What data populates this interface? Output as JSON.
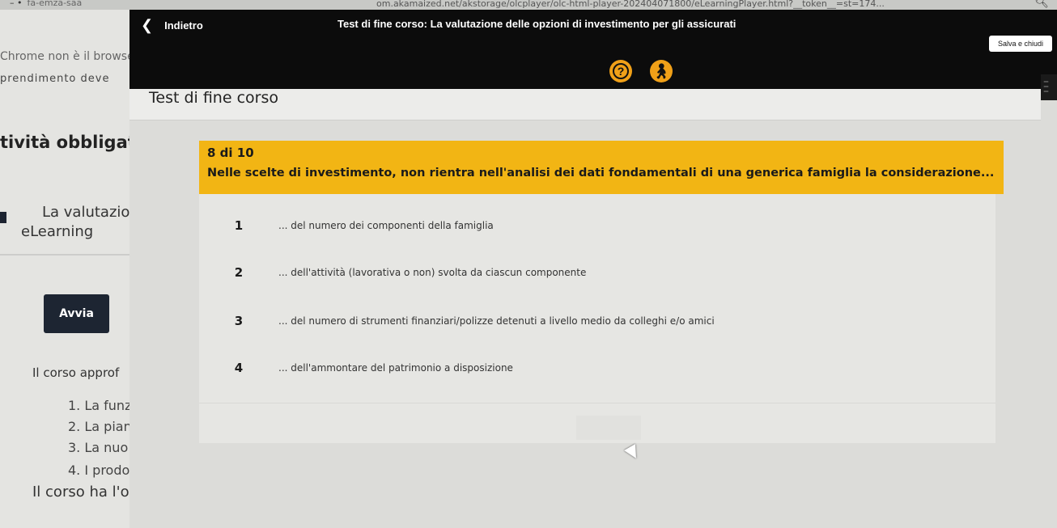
{
  "browser": {
    "tab_label": "fa-emza-saa",
    "url": "om.akamaized.net/akstorage/olcplayer/olc-html-player-202404071800/eLearningPlayer.html?__token__=st=174...",
    "search_icon": "magnifier-icon"
  },
  "background_page": {
    "browser_notice": "Chrome non è il browse",
    "partial_heading": "prendimento deve",
    "activity_heading": "tività obbligat",
    "course_title_line1": "La valutazion",
    "course_title_line2": "eLearning",
    "start_button": "Avvia",
    "course_intro": "Il corso approf",
    "list_items": [
      "1. La funz",
      "2. La pian",
      "3. La nuo",
      "4. I prodo"
    ],
    "closing_text": "Il corso ha l'o"
  },
  "player": {
    "back_label": "Indietro",
    "back_icon": "chevron-left-icon",
    "course_title": "Test di fine corso: La valutazione delle opzioni di investimento per gli assicurati",
    "save_close_label": "Salva e chiudi",
    "help_icon": "question-mark-icon",
    "accessibility_icon": "accessibility-icon",
    "menu_icon": "list-menu-icon",
    "accent_color": "#f2b514",
    "section_title": "Test di fine corso"
  },
  "question": {
    "counter": "8 di 10",
    "text": "Nelle scelte di investimento, non rientra nell'analisi dei dati fondamentali di una generica famiglia la considerazione...",
    "answers": [
      {
        "number": "1",
        "text": "... del numero dei componenti della famiglia"
      },
      {
        "number": "2",
        "text": "... dell'attività (lavorativa o non) svolta da ciascun componente"
      },
      {
        "number": "3",
        "text": "... del numero di strumenti finanziari/polizze detenuti a livello medio da colleghi e/o amici"
      },
      {
        "number": "4",
        "text": "... dell'ammontare del patrimonio a disposizione"
      }
    ]
  }
}
